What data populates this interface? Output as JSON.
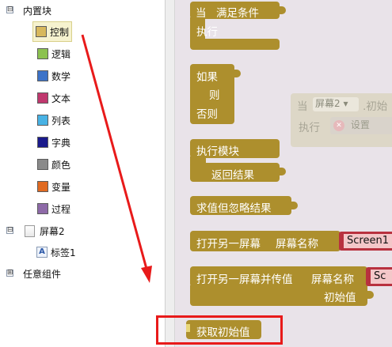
{
  "tree": {
    "root_label": "内置块",
    "categories": [
      {
        "label": "控制",
        "color": "#d8b85c"
      },
      {
        "label": "逻辑",
        "color": "#8cc250"
      },
      {
        "label": "数学",
        "color": "#3d73c8"
      },
      {
        "label": "文本",
        "color": "#c0386e"
      },
      {
        "label": "列表",
        "color": "#48b2e4"
      },
      {
        "label": "字典",
        "color": "#1a1a8c"
      },
      {
        "label": "颜色",
        "color": "#8a8a8a"
      },
      {
        "label": "变量",
        "color": "#e06a22"
      },
      {
        "label": "过程",
        "color": "#8e6aa8"
      }
    ],
    "screen_label": "屏幕2",
    "label_component": "标签1",
    "any_component": "任意组件",
    "collapse_symbol": "⊟",
    "expand_symbol": "⊞"
  },
  "blocks": {
    "when_label": "当",
    "condition_label": "满足条件",
    "exec_label": "执行",
    "if_label": "如果",
    "then_label": "则",
    "else_label": "否则",
    "do_module_label": "执行模块",
    "return_label": "返回结果",
    "eval_ignore_label": "求值但忽略结果",
    "open_screen_label": "打开另一屏幕",
    "screen_name_label": "屏幕名称",
    "open_screen_value": "Screen1",
    "open_screen_with_value_label": "打开另一屏幕并传值",
    "screen_name_label_2": "屏幕名称",
    "start_value_label": "初始值",
    "value_stub": "Sc",
    "get_start_value_label": "获取初始值"
  },
  "ghost_block": {
    "when_label": "当",
    "screen_dropdown": "屏幕2",
    "dropdown_arrow": "▾",
    "event_label": ".初始",
    "exec_label": "执行",
    "set_label": "设置",
    "x_symbol": "✕"
  },
  "colors": {
    "control_block": "#ad8f2d",
    "text_socket": "#b8313f",
    "workspace_bg": "#e9e3e9",
    "annotation_red": "#e81a1a"
  }
}
